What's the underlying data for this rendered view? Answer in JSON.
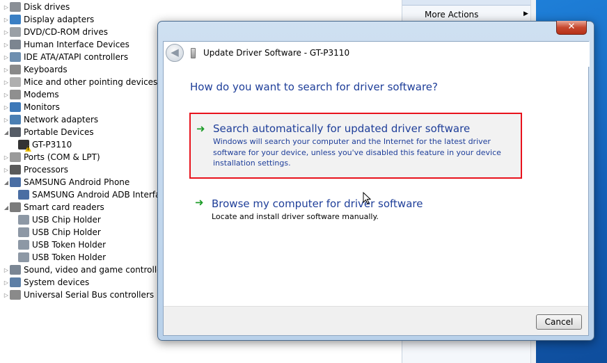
{
  "device_tree": {
    "items": [
      {
        "label": "Disk drives",
        "expander": "▷",
        "icon_color": "#8a8f96",
        "warn": false
      },
      {
        "label": "Display adapters",
        "expander": "▷",
        "icon_color": "#3a7fc4",
        "warn": false
      },
      {
        "label": "DVD/CD-ROM drives",
        "expander": "▷",
        "icon_color": "#9aa0a6",
        "warn": false
      },
      {
        "label": "Human Interface Devices",
        "expander": "▷",
        "icon_color": "#7c8590",
        "warn": false
      },
      {
        "label": "IDE ATA/ATAPI controllers",
        "expander": "▷",
        "icon_color": "#6e8fb0",
        "warn": false
      },
      {
        "label": "Keyboards",
        "expander": "▷",
        "icon_color": "#8a8a8a",
        "warn": false
      },
      {
        "label": "Mice and other pointing devices",
        "expander": "▷",
        "icon_color": "#b0b0b0",
        "warn": false
      },
      {
        "label": "Modems",
        "expander": "▷",
        "icon_color": "#8f8f8f",
        "warn": false
      },
      {
        "label": "Monitors",
        "expander": "▷",
        "icon_color": "#3d78b8",
        "warn": false
      },
      {
        "label": "Network adapters",
        "expander": "▷",
        "icon_color": "#4b7fb3",
        "warn": false
      },
      {
        "label": "Portable Devices",
        "expander": "◢",
        "icon_color": "#555c66",
        "warn": false
      },
      {
        "label": "GT-P3110",
        "expander": "",
        "icon_color": "#333333",
        "warn": true,
        "child": true
      },
      {
        "label": "Ports (COM & LPT)",
        "expander": "▷",
        "icon_color": "#9a9a9a",
        "warn": false
      },
      {
        "label": "Processors",
        "expander": "▷",
        "icon_color": "#5a5a5a",
        "warn": false
      },
      {
        "label": "SAMSUNG Android Phone",
        "expander": "◢",
        "icon_color": "#4a6ea3",
        "warn": false
      },
      {
        "label": "SAMSUNG Android ADB Interfa",
        "expander": "",
        "icon_color": "#4a6ea3",
        "warn": false,
        "child": true
      },
      {
        "label": "Smart card readers",
        "expander": "◢",
        "icon_color": "#7b7b7b",
        "warn": false
      },
      {
        "label": "USB Chip Holder",
        "expander": "",
        "icon_color": "#8d98a5",
        "warn": false,
        "child": true
      },
      {
        "label": "USB Chip Holder",
        "expander": "",
        "icon_color": "#8d98a5",
        "warn": false,
        "child": true
      },
      {
        "label": "USB Token Holder",
        "expander": "",
        "icon_color": "#8d98a5",
        "warn": false,
        "child": true
      },
      {
        "label": "USB Token Holder",
        "expander": "",
        "icon_color": "#8d98a5",
        "warn": false,
        "child": true
      },
      {
        "label": "Sound, video and game controllers",
        "expander": "▷",
        "icon_color": "#7a8694",
        "warn": false
      },
      {
        "label": "System devices",
        "expander": "▷",
        "icon_color": "#5d7fa6",
        "warn": false
      },
      {
        "label": "Universal Serial Bus controllers",
        "expander": "▷",
        "icon_color": "#8a8a8a",
        "warn": false
      }
    ]
  },
  "actions_panel": {
    "more_actions": "More Actions",
    "more_arrow": "▶"
  },
  "dialog": {
    "close_glyph": "✕",
    "back_glyph": "◀",
    "title": "Update Driver Software - GT-P3110",
    "question": "How do you want to search for driver software?",
    "option_auto": {
      "arrow": "➜",
      "title": "Search automatically for updated driver software",
      "description": "Windows will search your computer and the Internet for the latest driver software for your device, unless you've disabled this feature in your device installation settings."
    },
    "option_browse": {
      "arrow": "➜",
      "title": "Browse my computer for driver software",
      "description": "Locate and install driver software manually."
    },
    "cancel_label": "Cancel"
  },
  "colors": {
    "link_blue": "#1e3e99",
    "highlight_red": "#e8121c",
    "arrow_green": "#1f9d2a"
  }
}
